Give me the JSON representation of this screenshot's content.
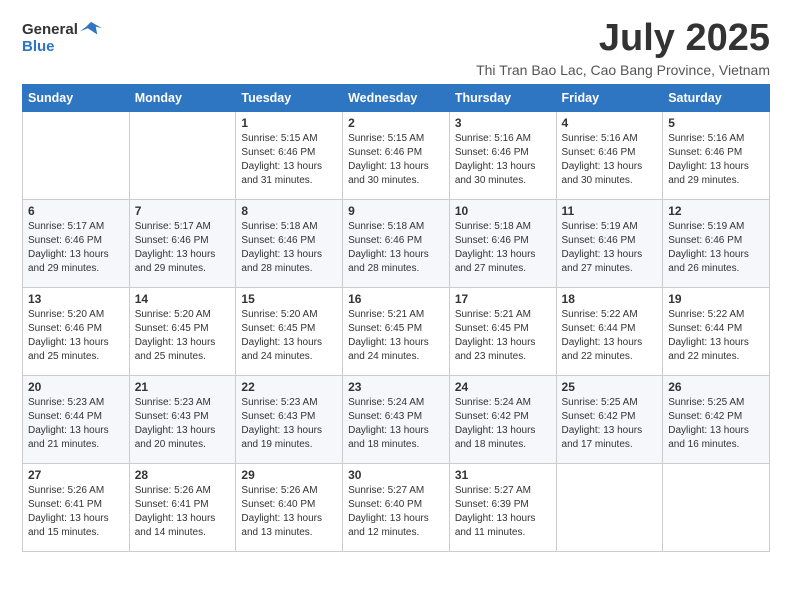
{
  "header": {
    "logo_line1": "General",
    "logo_line2": "Blue",
    "month_title": "July 2025",
    "location": "Thi Tran Bao Lac, Cao Bang Province, Vietnam"
  },
  "weekdays": [
    "Sunday",
    "Monday",
    "Tuesday",
    "Wednesday",
    "Thursday",
    "Friday",
    "Saturday"
  ],
  "weeks": [
    [
      {
        "day": "",
        "info": ""
      },
      {
        "day": "",
        "info": ""
      },
      {
        "day": "1",
        "info": "Sunrise: 5:15 AM\nSunset: 6:46 PM\nDaylight: 13 hours and 31 minutes."
      },
      {
        "day": "2",
        "info": "Sunrise: 5:15 AM\nSunset: 6:46 PM\nDaylight: 13 hours and 30 minutes."
      },
      {
        "day": "3",
        "info": "Sunrise: 5:16 AM\nSunset: 6:46 PM\nDaylight: 13 hours and 30 minutes."
      },
      {
        "day": "4",
        "info": "Sunrise: 5:16 AM\nSunset: 6:46 PM\nDaylight: 13 hours and 30 minutes."
      },
      {
        "day": "5",
        "info": "Sunrise: 5:16 AM\nSunset: 6:46 PM\nDaylight: 13 hours and 29 minutes."
      }
    ],
    [
      {
        "day": "6",
        "info": "Sunrise: 5:17 AM\nSunset: 6:46 PM\nDaylight: 13 hours and 29 minutes."
      },
      {
        "day": "7",
        "info": "Sunrise: 5:17 AM\nSunset: 6:46 PM\nDaylight: 13 hours and 29 minutes."
      },
      {
        "day": "8",
        "info": "Sunrise: 5:18 AM\nSunset: 6:46 PM\nDaylight: 13 hours and 28 minutes."
      },
      {
        "day": "9",
        "info": "Sunrise: 5:18 AM\nSunset: 6:46 PM\nDaylight: 13 hours and 28 minutes."
      },
      {
        "day": "10",
        "info": "Sunrise: 5:18 AM\nSunset: 6:46 PM\nDaylight: 13 hours and 27 minutes."
      },
      {
        "day": "11",
        "info": "Sunrise: 5:19 AM\nSunset: 6:46 PM\nDaylight: 13 hours and 27 minutes."
      },
      {
        "day": "12",
        "info": "Sunrise: 5:19 AM\nSunset: 6:46 PM\nDaylight: 13 hours and 26 minutes."
      }
    ],
    [
      {
        "day": "13",
        "info": "Sunrise: 5:20 AM\nSunset: 6:46 PM\nDaylight: 13 hours and 25 minutes."
      },
      {
        "day": "14",
        "info": "Sunrise: 5:20 AM\nSunset: 6:45 PM\nDaylight: 13 hours and 25 minutes."
      },
      {
        "day": "15",
        "info": "Sunrise: 5:20 AM\nSunset: 6:45 PM\nDaylight: 13 hours and 24 minutes."
      },
      {
        "day": "16",
        "info": "Sunrise: 5:21 AM\nSunset: 6:45 PM\nDaylight: 13 hours and 24 minutes."
      },
      {
        "day": "17",
        "info": "Sunrise: 5:21 AM\nSunset: 6:45 PM\nDaylight: 13 hours and 23 minutes."
      },
      {
        "day": "18",
        "info": "Sunrise: 5:22 AM\nSunset: 6:44 PM\nDaylight: 13 hours and 22 minutes."
      },
      {
        "day": "19",
        "info": "Sunrise: 5:22 AM\nSunset: 6:44 PM\nDaylight: 13 hours and 22 minutes."
      }
    ],
    [
      {
        "day": "20",
        "info": "Sunrise: 5:23 AM\nSunset: 6:44 PM\nDaylight: 13 hours and 21 minutes."
      },
      {
        "day": "21",
        "info": "Sunrise: 5:23 AM\nSunset: 6:43 PM\nDaylight: 13 hours and 20 minutes."
      },
      {
        "day": "22",
        "info": "Sunrise: 5:23 AM\nSunset: 6:43 PM\nDaylight: 13 hours and 19 minutes."
      },
      {
        "day": "23",
        "info": "Sunrise: 5:24 AM\nSunset: 6:43 PM\nDaylight: 13 hours and 18 minutes."
      },
      {
        "day": "24",
        "info": "Sunrise: 5:24 AM\nSunset: 6:42 PM\nDaylight: 13 hours and 18 minutes."
      },
      {
        "day": "25",
        "info": "Sunrise: 5:25 AM\nSunset: 6:42 PM\nDaylight: 13 hours and 17 minutes."
      },
      {
        "day": "26",
        "info": "Sunrise: 5:25 AM\nSunset: 6:42 PM\nDaylight: 13 hours and 16 minutes."
      }
    ],
    [
      {
        "day": "27",
        "info": "Sunrise: 5:26 AM\nSunset: 6:41 PM\nDaylight: 13 hours and 15 minutes."
      },
      {
        "day": "28",
        "info": "Sunrise: 5:26 AM\nSunset: 6:41 PM\nDaylight: 13 hours and 14 minutes."
      },
      {
        "day": "29",
        "info": "Sunrise: 5:26 AM\nSunset: 6:40 PM\nDaylight: 13 hours and 13 minutes."
      },
      {
        "day": "30",
        "info": "Sunrise: 5:27 AM\nSunset: 6:40 PM\nDaylight: 13 hours and 12 minutes."
      },
      {
        "day": "31",
        "info": "Sunrise: 5:27 AM\nSunset: 6:39 PM\nDaylight: 13 hours and 11 minutes."
      },
      {
        "day": "",
        "info": ""
      },
      {
        "day": "",
        "info": ""
      }
    ]
  ]
}
